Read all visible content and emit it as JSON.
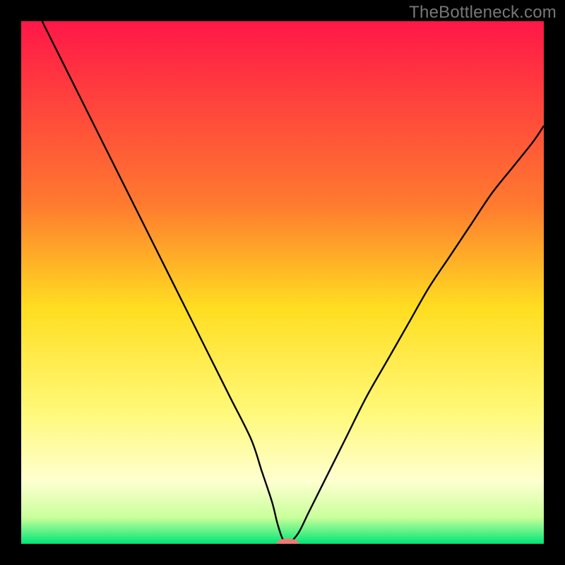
{
  "watermark": "TheBottleneck.com",
  "chart_data": {
    "type": "line",
    "title": "",
    "xlabel": "",
    "ylabel": "",
    "xlim": [
      0,
      100
    ],
    "ylim": [
      0,
      100
    ],
    "grid": false,
    "legend": false,
    "background_gradient": [
      {
        "stop": 0.0,
        "color": "#ff1748"
      },
      {
        "stop": 0.35,
        "color": "#ff7a2f"
      },
      {
        "stop": 0.55,
        "color": "#ffde21"
      },
      {
        "stop": 0.75,
        "color": "#fff97a"
      },
      {
        "stop": 0.88,
        "color": "#ffffd0"
      },
      {
        "stop": 0.95,
        "color": "#c8ff9a"
      },
      {
        "stop": 1.0,
        "color": "#00e676"
      }
    ],
    "series": [
      {
        "name": "bottleneck-curve",
        "stroke": "#000000",
        "x": [
          4,
          8,
          12,
          16,
          20,
          24,
          28,
          32,
          36,
          40,
          44,
          46,
          48,
          49,
          50,
          51,
          53,
          55,
          58,
          62,
          66,
          70,
          74,
          78,
          82,
          86,
          90,
          94,
          98,
          100
        ],
        "y": [
          100,
          92,
          84,
          76,
          68,
          60,
          52,
          44,
          36,
          28,
          20,
          14,
          8,
          4,
          1,
          0,
          2,
          6,
          12,
          20,
          28,
          35,
          42,
          49,
          55,
          61,
          67,
          72,
          77,
          80
        ]
      }
    ],
    "marker": {
      "name": "selected-point",
      "x": 51,
      "y": 0,
      "color": "#ef7a74",
      "rx": 2.2,
      "ry": 1.0
    }
  }
}
